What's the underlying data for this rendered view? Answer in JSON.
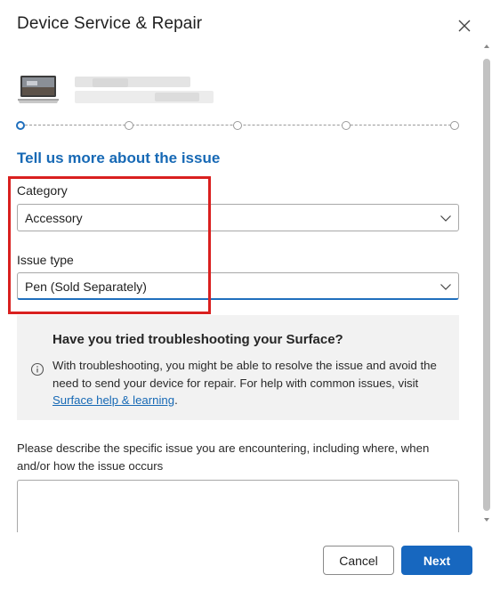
{
  "dialog": {
    "title": "Device Service & Repair",
    "close_icon": "close-icon"
  },
  "device": {
    "icon": "laptop-icon",
    "name_redacted": true
  },
  "stepper": {
    "steps": 5,
    "active_step": 1
  },
  "form": {
    "heading": "Tell us more about the issue",
    "category": {
      "label": "Category",
      "value": "Accessory"
    },
    "issue_type": {
      "label": "Issue type",
      "value": "Pen (Sold Separately)"
    },
    "info": {
      "title": "Have you tried troubleshooting your Surface?",
      "body_before_link": "With troubleshooting, you might be able to resolve the issue and avoid the need to send your device for repair. For help with common issues, visit ",
      "link_text": "Surface help & learning",
      "body_after_link": "."
    },
    "describe": {
      "label": "Please describe the specific issue you are encountering, including where, when and/or how the issue occurs",
      "value": ""
    }
  },
  "footer": {
    "cancel_label": "Cancel",
    "next_label": "Next"
  },
  "colors": {
    "accent": "#1767bf",
    "heading": "#1769b5",
    "highlight": "#d9201f",
    "info_bg": "#f2f2f2"
  }
}
